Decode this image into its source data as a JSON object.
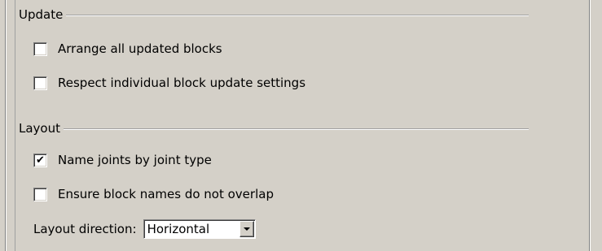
{
  "update_group": {
    "title": "Update",
    "options": [
      {
        "label": "Arrange all updated blocks",
        "checked": false,
        "mark": ""
      },
      {
        "label": "Respect individual block update settings",
        "checked": false,
        "mark": ""
      }
    ]
  },
  "layout_group": {
    "title": "Layout",
    "options": [
      {
        "label": "Name joints by joint type",
        "checked": true,
        "mark": "✔"
      },
      {
        "label": "Ensure block names do not overlap",
        "checked": false,
        "mark": ""
      }
    ],
    "direction": {
      "label": "Layout direction:",
      "value": "Horizontal"
    }
  }
}
